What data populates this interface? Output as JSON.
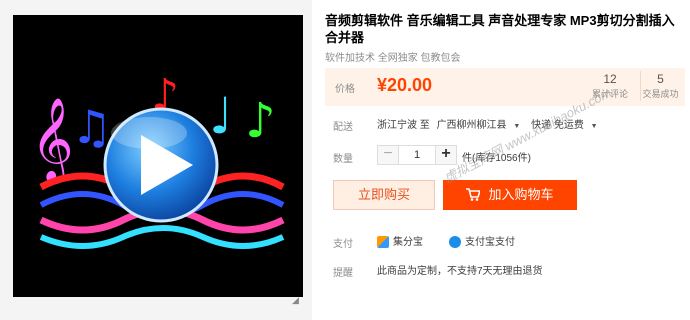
{
  "product": {
    "title": "音频剪辑软件 音乐编辑工具 声音处理专家 MP3剪切分割插入合并器",
    "subtitle": "软件加技术  全网独家  包教包会"
  },
  "price": {
    "label": "价格",
    "value": "¥20.00"
  },
  "stats": {
    "reviews_count": "12",
    "reviews_label": "累计评论",
    "deals_count": "5",
    "deals_label": "交易成功"
  },
  "shipping": {
    "label": "配送",
    "from": "浙江宁波 至",
    "to": "广西柳州柳江县",
    "method": "快递 免运费"
  },
  "quantity": {
    "label": "数量",
    "value": "1",
    "minus": "−",
    "plus": "+",
    "unit": "件(库存1056件)"
  },
  "buttons": {
    "buy_now": "立即购买",
    "add_cart": "加入购物车"
  },
  "payment": {
    "label": "支付",
    "option1": "集分宝",
    "option2": "支付宝支付"
  },
  "note": {
    "label": "提醒",
    "text": "此商品为定制，不支持7天无理由退货"
  },
  "watermark": "虚拟宝库网 www.xunibaoku.com",
  "colors": {
    "price_orange": "#ff4400",
    "price_bg": "#fff2e8",
    "buy_bg": "#ffeee2"
  },
  "icons": {
    "play": "play-circle-icon",
    "cart": "cart-icon",
    "expand": "expand-icon"
  }
}
